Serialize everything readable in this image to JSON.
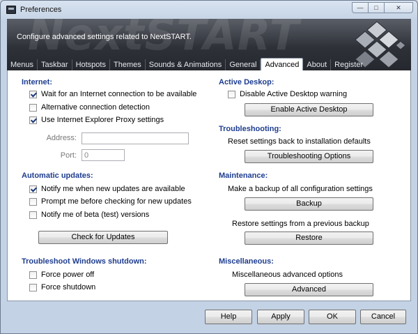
{
  "window": {
    "title": "Preferences",
    "controls": {
      "minimize": "—",
      "maximize": "□",
      "close": "✕"
    }
  },
  "banner": {
    "watermark": "NextSTART",
    "text": "Configure advanced settings related to NextSTART."
  },
  "tabs": [
    {
      "label": "Menus"
    },
    {
      "label": "Taskbar"
    },
    {
      "label": "Hotspots"
    },
    {
      "label": "Themes"
    },
    {
      "label": "Sounds & Animations"
    },
    {
      "label": "General"
    },
    {
      "label": "Advanced",
      "active": true
    },
    {
      "label": "About"
    },
    {
      "label": "Register"
    }
  ],
  "internet": {
    "title": "Internet:",
    "wait_connection": {
      "label": "Wait for an Internet connection to be available",
      "checked": true
    },
    "alt_detection": {
      "label": "Alternative connection detection",
      "checked": false
    },
    "use_ie_proxy": {
      "label": "Use Internet Explorer Proxy settings",
      "checked": true
    },
    "address_label": "Address:",
    "address_value": "",
    "port_label": "Port:",
    "port_value": "0"
  },
  "updates": {
    "title": "Automatic updates:",
    "notify_new": {
      "label": "Notify me when new updates are available",
      "checked": true
    },
    "prompt_before": {
      "label": "Prompt me before checking for new updates",
      "checked": false
    },
    "notify_beta": {
      "label": "Notify me of beta (test) versions",
      "checked": false
    },
    "check_button": "Check for Updates"
  },
  "shutdown": {
    "title": "Troubleshoot Windows shutdown:",
    "force_power_off": {
      "label": "Force power off",
      "checked": false
    },
    "force_shutdown": {
      "label": "Force shutdown",
      "checked": false
    }
  },
  "active_desktop": {
    "title": "Active Deskop:",
    "disable_warning": {
      "label": "Disable Active Desktop warning",
      "checked": false
    },
    "enable_button": "Enable Active Desktop"
  },
  "troubleshooting": {
    "title": "Troubleshooting:",
    "description": "Reset settings back to installation defaults",
    "options_button": "Troubleshooting Options"
  },
  "maintenance": {
    "title": "Maintenance:",
    "backup_description": "Make a backup of all configuration settings",
    "backup_button": "Backup",
    "restore_description": "Restore settings from a previous backup",
    "restore_button": "Restore"
  },
  "misc": {
    "title": "Miscellaneous:",
    "description": "Miscellaneous advanced options",
    "advanced_button": "Advanced"
  },
  "footer": {
    "help": "Help",
    "apply": "Apply",
    "ok": "OK",
    "cancel": "Cancel"
  }
}
